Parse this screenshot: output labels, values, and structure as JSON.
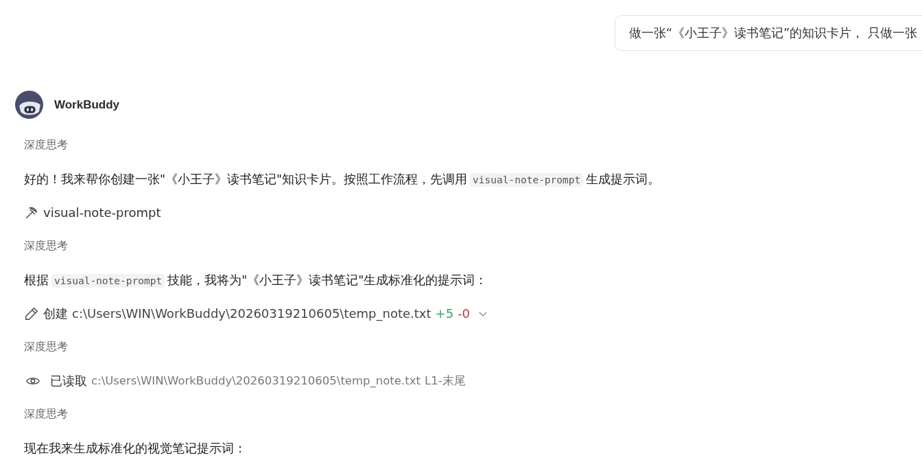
{
  "user_message": "做一张“《小王子》读书笔记”的知识卡片， 只做一张",
  "assistant": {
    "name": "WorkBuddy"
  },
  "blocks": [
    {
      "kind": "thinking",
      "label": "深度思考"
    },
    {
      "kind": "paragraph",
      "segments": [
        {
          "kind": "text",
          "text": "好的！我来帮你创建一张\"《小王子》读书笔记\"知识卡片。按照工作流程，先调用"
        },
        {
          "kind": "code",
          "text": "visual-note-prompt"
        },
        {
          "kind": "text",
          "text": "生成提示词。"
        }
      ]
    },
    {
      "kind": "skill",
      "name": "visual-note-prompt"
    },
    {
      "kind": "thinking",
      "label": "深度思考"
    },
    {
      "kind": "paragraph",
      "segments": [
        {
          "kind": "text",
          "text": "根据"
        },
        {
          "kind": "code",
          "text": "visual-note-prompt"
        },
        {
          "kind": "text",
          "text": "技能，我将为\"《小王子》读书笔记\"生成标准化的提示词："
        }
      ]
    },
    {
      "kind": "file_create",
      "action": "创建",
      "path": "c:\\Users\\WIN\\WorkBuddy\\20260319210605\\temp_note.txt",
      "added": "+5",
      "removed": "-0",
      "expanded": false
    },
    {
      "kind": "thinking",
      "label": "深度思考"
    },
    {
      "kind": "file_read",
      "action": "已读取",
      "path": "c:\\Users\\WIN\\WorkBuddy\\20260319210605\\temp_note.txt",
      "range": "L1-末尾"
    },
    {
      "kind": "thinking",
      "label": "深度思考"
    },
    {
      "kind": "paragraph",
      "segments": [
        {
          "kind": "text",
          "text": "现在我来生成标准化的视觉笔记提示词："
        }
      ]
    }
  ]
}
